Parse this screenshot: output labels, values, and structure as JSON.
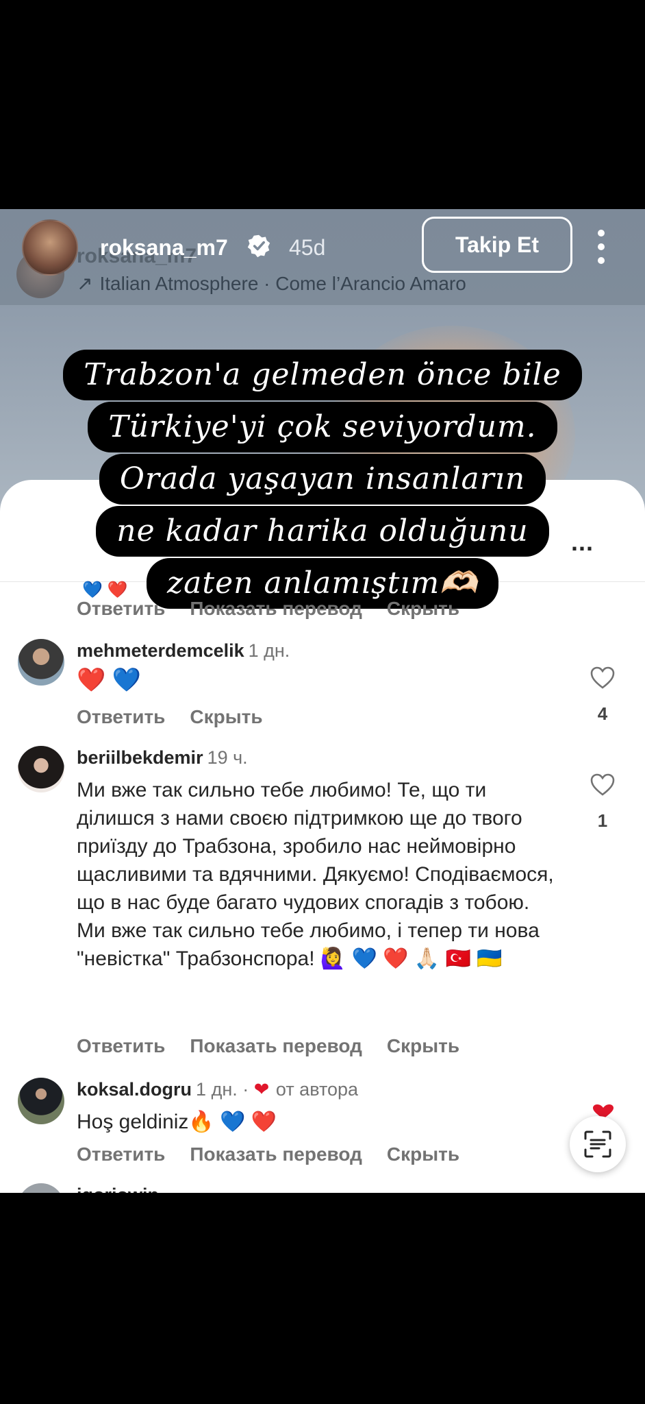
{
  "header": {
    "username": "roksana_m7",
    "ghost_username": "roksana_m7",
    "time_ago": "45d",
    "follow_label": "Takip Et",
    "music": "Italian Atmosphere · Come l’Arancio Amaro"
  },
  "caption": {
    "lines": [
      "Trabzon'a gelmeden önce bile",
      "Türkiye'yi çok seviyordum.",
      "Orada yaşayan insanların",
      "ne kadar harika olduğunu",
      "zaten anlamıştım🫶🏻"
    ]
  },
  "sheet": {
    "more_label": "..."
  },
  "actions": {
    "reply": "Ответить",
    "translate": "Показать перевод",
    "hide": "Скрыть"
  },
  "comments": [
    {
      "user": "mehmeterdemcelik",
      "time": "1 дн.",
      "text": "❤️ 💙",
      "likes": "4"
    },
    {
      "user": "beriilbekdemir",
      "time": "19 ч.",
      "text": "Ми вже так сильно тебе любимо! Те, що ти ділишся з нами своєю підтримкою ще до твого приїзду до Трабзона, зробило нас неймовірно щасливими та вдячними. Дякуємо! Сподіваємося, що в нас буде багато чудових спогадів з тобою. Ми вже так сильно тебе любимо, і тепер ти нова \"невістка\" Трабзонспора! 🙋‍♀️ 💙 ❤️ 🙏🏻 🇹🇷 🇺🇦",
      "likes": "1"
    },
    {
      "user": "koksal.dogru",
      "time": "1 дн. ·",
      "author_label": "от автора",
      "text": "Hoş geldiniz🔥 💙 ❤️"
    }
  ],
  "cutoff_user": "igorjowin",
  "colors": {
    "action_gray": "#737373",
    "heart_red": "#e0162b",
    "caption_bg": "#000000"
  }
}
